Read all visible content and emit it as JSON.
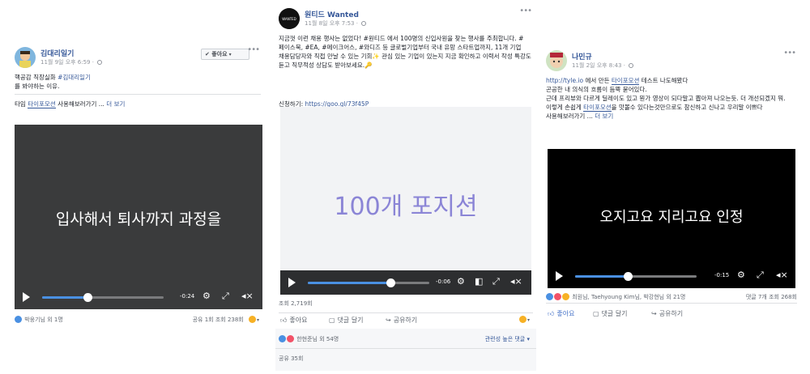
{
  "post1": {
    "name": "김대리일기",
    "meta": "11월 9일 오후 6:59 · ",
    "like_button": "✔ 좋아요",
    "text_line1": "핵공감 직장실화 ",
    "hashtag": "#김대리일기",
    "text_line2": "를 봐야하는 이유.",
    "tail_before": "타임 ",
    "tail_highlight": "타이포모션",
    "tail_after": " 사용해보러가기 ... ",
    "more": "더 보기",
    "video_caption": "입사해서 퇴사까지 과정을",
    "time": "-0:24",
    "progress": 0.37,
    "reactions": "박웅기님 외 1명",
    "stats": "공유 1회  조회 238회"
  },
  "post2": {
    "name": "원티드 Wanted",
    "meta": "11월 8일 오후 7:53 · ",
    "logo_text": "WANTED",
    "text": "지금껏 이런 채용 행사는 없었다! #원티드 에서 100명의 신입사원을 찾는 행사를 주최합니다. #페이스북, #EA, #메이크어스, #와디즈 등 글로벌기업부터 국내 유망 스타트업까지, 11개 기업 채용담당자와 직접 만날 수 있는 기회✨ 관심 있는 기업이 있는지 지금 확인하고 이력서 작성 특강도 듣고 직무적성 상담도 받아보세요.🔑",
    "link_label": "신청하기: ",
    "link": "https://goo.gl/73f45P",
    "video_caption": "100개 포지션",
    "time": "-0:06",
    "progress": 0.68,
    "views": "조회 2,719회",
    "action_like": "좋아요",
    "action_comment": "댓글 달기",
    "action_share": "공유하기",
    "reactions": "한현준님 외 54명",
    "sort_label": "관련성 높은 댓글 ▾",
    "shares": "공유 35회"
  },
  "post3": {
    "name": "나민규",
    "meta": "11월 2일 오후 8:43 · ",
    "url_text": "http://tyle.io",
    "line1_mid": " 에서 만든 ",
    "line1_hl": "타이포모션",
    "line1_end": " 테스트 나도해봤다",
    "line2": "곤공한 내 의식의 흐름이 듬뿍 묻어있다.",
    "line3a": "근데 프리뷰와 다르게 딜레이도 있고 뭔가 영상이 되다말고 뽑아져 나오는듯. 더 개선되겠지 뭐. 이렇게 손쉽게 ",
    "line3_hl": "타이포모션",
    "line3b": "을 맛볼수 있다는것만으로도 참신하고 신나고 우리말 이쁘다",
    "tail": "사용해보러가기 ... ",
    "more": "더 보기",
    "video_caption": "오지고요 지리고요 인정",
    "time": "-0:15",
    "progress": 0.43,
    "reactions": "최원님, Taehyoung Kim님, 박강현님 외 21명",
    "stats": "댓글 7개  조회 268회",
    "action_like": "좋아요",
    "action_comment": "댓글 달기",
    "action_share": "공유하기"
  }
}
